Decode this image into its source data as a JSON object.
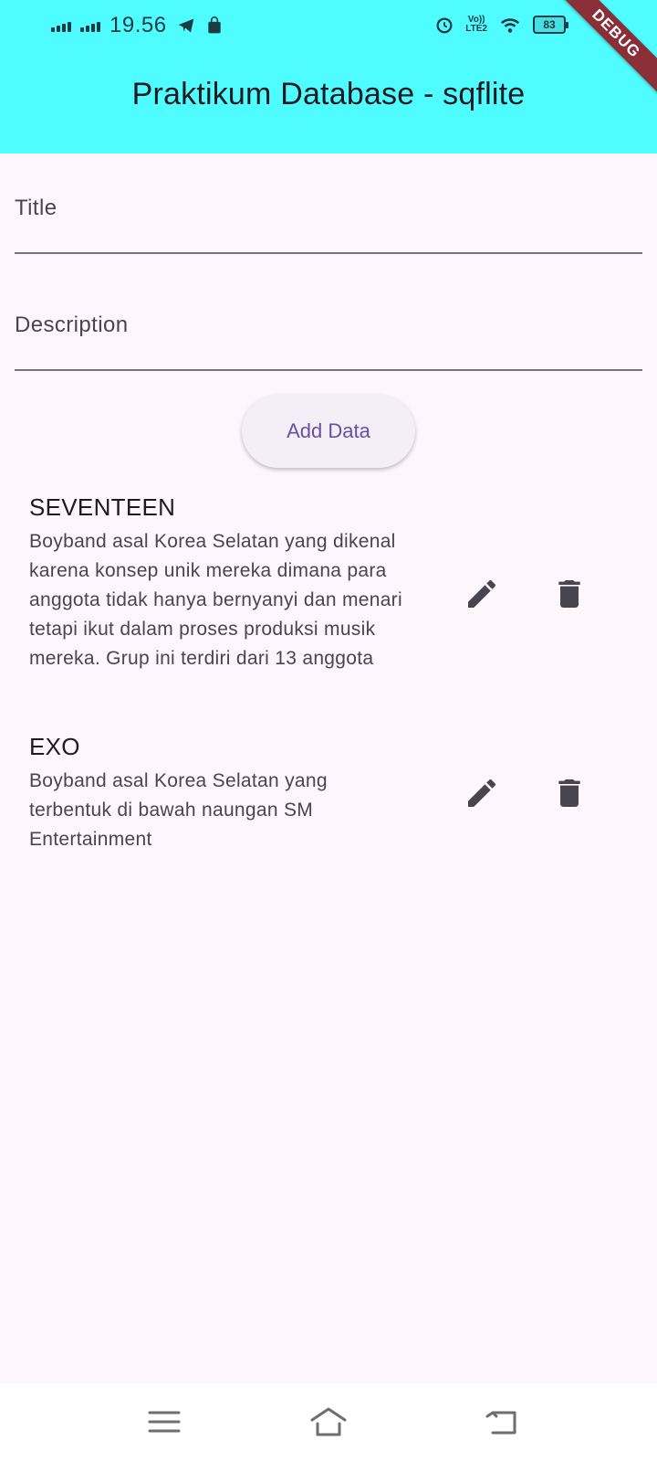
{
  "status_bar": {
    "time": "19.56",
    "network_label": "LTE2",
    "volte_label": "Vo))",
    "battery": "83",
    "icons": [
      "signal-icon",
      "telegram-icon",
      "shop-icon",
      "alarm-icon",
      "wifi-icon",
      "battery-icon"
    ]
  },
  "app_bar": {
    "title": "Praktikum Database - sqflite",
    "debug_banner": "DEBUG",
    "color": "#4ffcff"
  },
  "form": {
    "title_placeholder": "Title",
    "description_placeholder": "Description",
    "add_button": "Add Data"
  },
  "items": [
    {
      "title": "SEVENTEEN",
      "description": "Boyband asal Korea Selatan yang dikenal karena konsep unik mereka dimana para anggota tidak hanya bernyanyi dan menari tetapi ikut dalam proses produksi musik mereka. Grup ini terdiri dari 13 anggota"
    },
    {
      "title": "EXO",
      "description": "Boyband asal Korea Selatan yang terbentuk di bawah naungan SM Entertainment"
    }
  ],
  "navigation": {
    "icons": [
      "menu-icon",
      "home-icon",
      "back-icon"
    ]
  },
  "colors": {
    "background": "#fdf7fd",
    "accent": "#6750a4",
    "icon": "#49454f"
  }
}
